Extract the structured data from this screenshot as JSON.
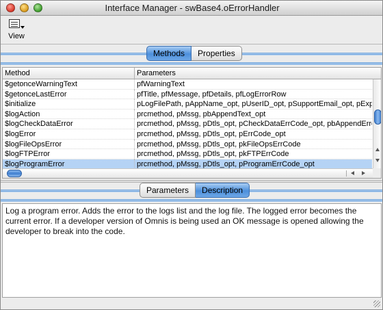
{
  "window": {
    "title": "Interface Manager - swBase4.oErrorHandler"
  },
  "toolbar": {
    "view_label": "View"
  },
  "top_tabs": [
    {
      "label": "Methods",
      "active": true
    },
    {
      "label": "Properties",
      "active": false
    }
  ],
  "table": {
    "columns": [
      "Method",
      "Parameters"
    ],
    "rows": [
      {
        "method": "$getonceWarningText",
        "params": "pfWarningText",
        "selected": false
      },
      {
        "method": "$getonceLastError",
        "params": "pfTitle, pfMessage, pfDetails, pfLogErrorRow",
        "selected": false
      },
      {
        "method": "$initialize",
        "params": "pLogFilePath, pAppName_opt, pUserID_opt, pSupportEmail_opt, pExpir",
        "selected": false
      },
      {
        "method": "$logAction",
        "params": "prcmethod, pMssg, pbAppendText_opt",
        "selected": false
      },
      {
        "method": "$logCheckDataError",
        "params": "prcmethod, pMssg, pDtls_opt, pCheckDataErrCode_opt, pbAppendError",
        "selected": false
      },
      {
        "method": "$logError",
        "params": "prcmethod, pMssg, pDtls_opt, pErrCode_opt",
        "selected": false
      },
      {
        "method": "$logFileOpsError",
        "params": "prcmethod, pMssg, pDtls_opt, pkFileOpsErrCode",
        "selected": false
      },
      {
        "method": "$logFTPError",
        "params": "prcmethod, pMssg, pDtls_opt, pkFTPErrCode",
        "selected": false
      },
      {
        "method": "$logProgramError",
        "params": "prcmethod, pMssg, pDtls_opt, pProgramErrCode_opt",
        "selected": true
      }
    ]
  },
  "bottom_tabs": [
    {
      "label": "Parameters",
      "active": false
    },
    {
      "label": "Description",
      "active": true
    }
  ],
  "description": "Log a program error. Adds the error to the logs list and the log file. The logged error becomes the current error. If a developer version of Omnis is being used an OK message is opened allowing the developer to break into the code.",
  "colors": {
    "accent": "#4c8fdb",
    "selection": "#b5d3f5"
  }
}
